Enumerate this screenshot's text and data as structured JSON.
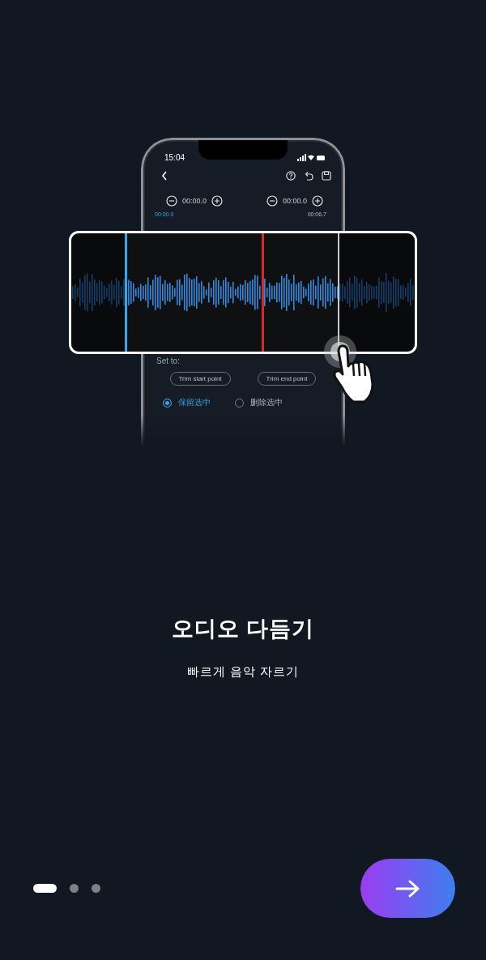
{
  "phone": {
    "status_time": "15:04",
    "start_time": "00:00.0",
    "end_time": "00:00.0",
    "range_start": "00:00.0",
    "range_end": "00:06.7",
    "set_to_label": "Set to:",
    "buttons": [
      {
        "label": "Trim start point"
      },
      {
        "label": "Trim end point"
      }
    ],
    "options": [
      {
        "label": "保留选中",
        "selected": true
      },
      {
        "label": "删除选中",
        "selected": false
      }
    ]
  },
  "title": "오디오 다듬기",
  "subtitle": "빠르게 음악 자르기",
  "pager": [
    {
      "selected": true
    },
    {
      "selected": false
    },
    {
      "selected": false
    }
  ]
}
